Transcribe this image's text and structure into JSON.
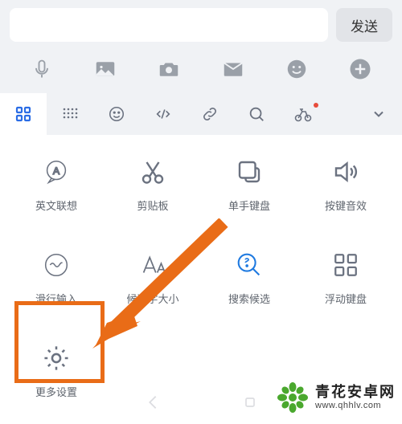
{
  "topbar": {
    "send_label": "发送"
  },
  "tabs": {
    "items": [
      "apps",
      "keypad",
      "emoji",
      "code",
      "link",
      "search",
      "bike"
    ],
    "active_index": 0,
    "has_red_dot_index": 6
  },
  "grid": {
    "items": [
      {
        "id": "english-suggest",
        "label": "英文联想",
        "icon": "a-bubble"
      },
      {
        "id": "clipboard",
        "label": "剪贴板",
        "icon": "scissors"
      },
      {
        "id": "onehand-keyboard",
        "label": "单手键盘",
        "icon": "overlap-square"
      },
      {
        "id": "key-sound",
        "label": "按键音效",
        "icon": "speaker"
      },
      {
        "id": "glide-input",
        "label": "滑行输入",
        "icon": "wave-circle"
      },
      {
        "id": "candidate-size",
        "label": "候选字大小",
        "icon": "font-size"
      },
      {
        "id": "search-candidate",
        "label": "搜索候选",
        "icon": "magnify-q",
        "highlight": "blue"
      },
      {
        "id": "float-keyboard",
        "label": "浮动键盘",
        "icon": "four-squares"
      },
      {
        "id": "more-settings",
        "label": "更多设置",
        "icon": "gear"
      }
    ]
  },
  "footer": {
    "brand": "青花安卓网",
    "domain": "www.qhhlv.com"
  }
}
